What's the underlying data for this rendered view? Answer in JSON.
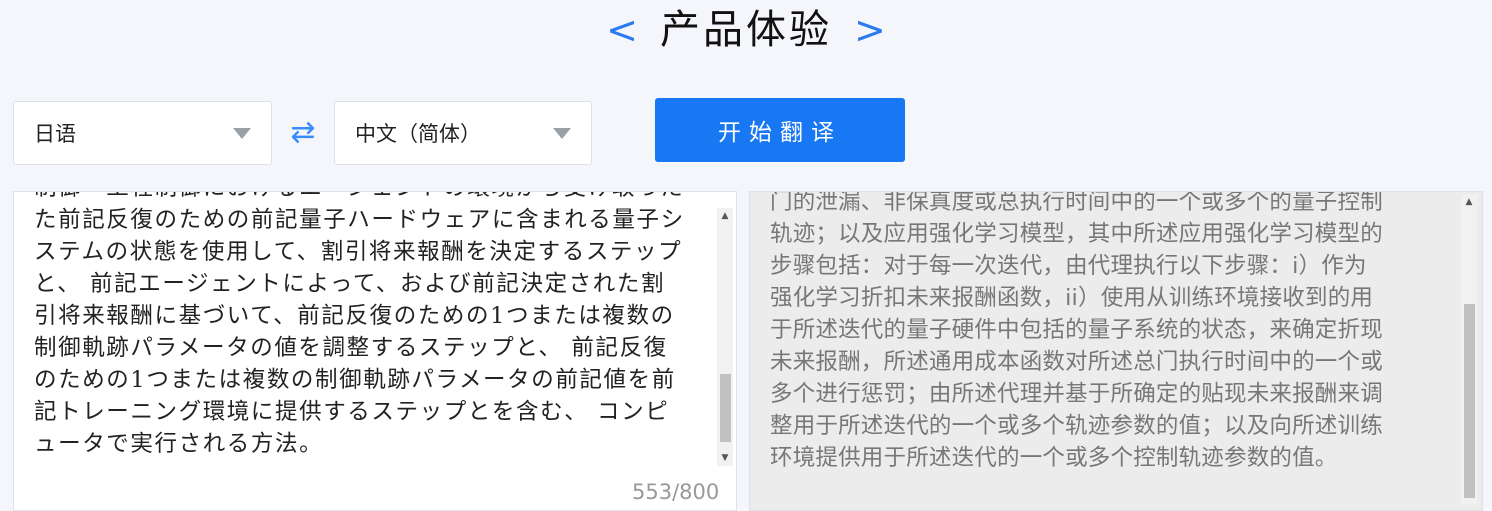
{
  "header": {
    "title": "产品体验",
    "prev_arrow": "<",
    "next_arrow": ">"
  },
  "controls": {
    "source_language": "日语",
    "target_language": "中文（简体）",
    "swap_icon": "⇄",
    "translate_button": "开始翻译"
  },
  "source_panel": {
    "text": "制御・工程制御におけるエージェントの環境から受け取った\nた前記反復のための前記量子ハードウェアに含まれる量子シ\nステムの状態を使用して、割引将来報酬を決定するステップ\nと、 前記エージェントによって、および前記決定された割\n引将来報酬に基づいて、前記反復のための1つまたは複数の\n制御軌跡パラメータの値を調整するステップと、 前記反復\nのための1つまたは複数の制御軌跡パラメータの前記値を前\n記トレーニング環境に提供するステップとを含む、 コンピ\nュータで実行される方法。",
    "char_count": "553/800"
  },
  "target_panel": {
    "text": "门的泄漏、非保真度或总执行时间中的一个或多个的量子控制\n轨迹；以及应用强化学习模型，其中所述应用强化学习模型的\n步骤包括：对于每一次迭代，由代理执行以下步骤：i）作为\n强化学习折扣未来报酬函数，ii）使用从训练环境接收到的用\n于所述迭代的量子硬件中包括的量子系统的状态，来确定折现\n未来报酬，所述通用成本函数对所述总门执行时间中的一个或\n多个进行惩罚；由所述代理并基于所确定的贴现未来报酬来调\n整用于所述迭代的一个或多个轨迹参数的值；以及向所述训练\n环境提供用于所述迭代的一个或多个控制轨迹参数的值。"
  },
  "colors": {
    "accent": "#1877f2",
    "arrow": "#2b7bf0",
    "background": "#f4f6fb"
  }
}
